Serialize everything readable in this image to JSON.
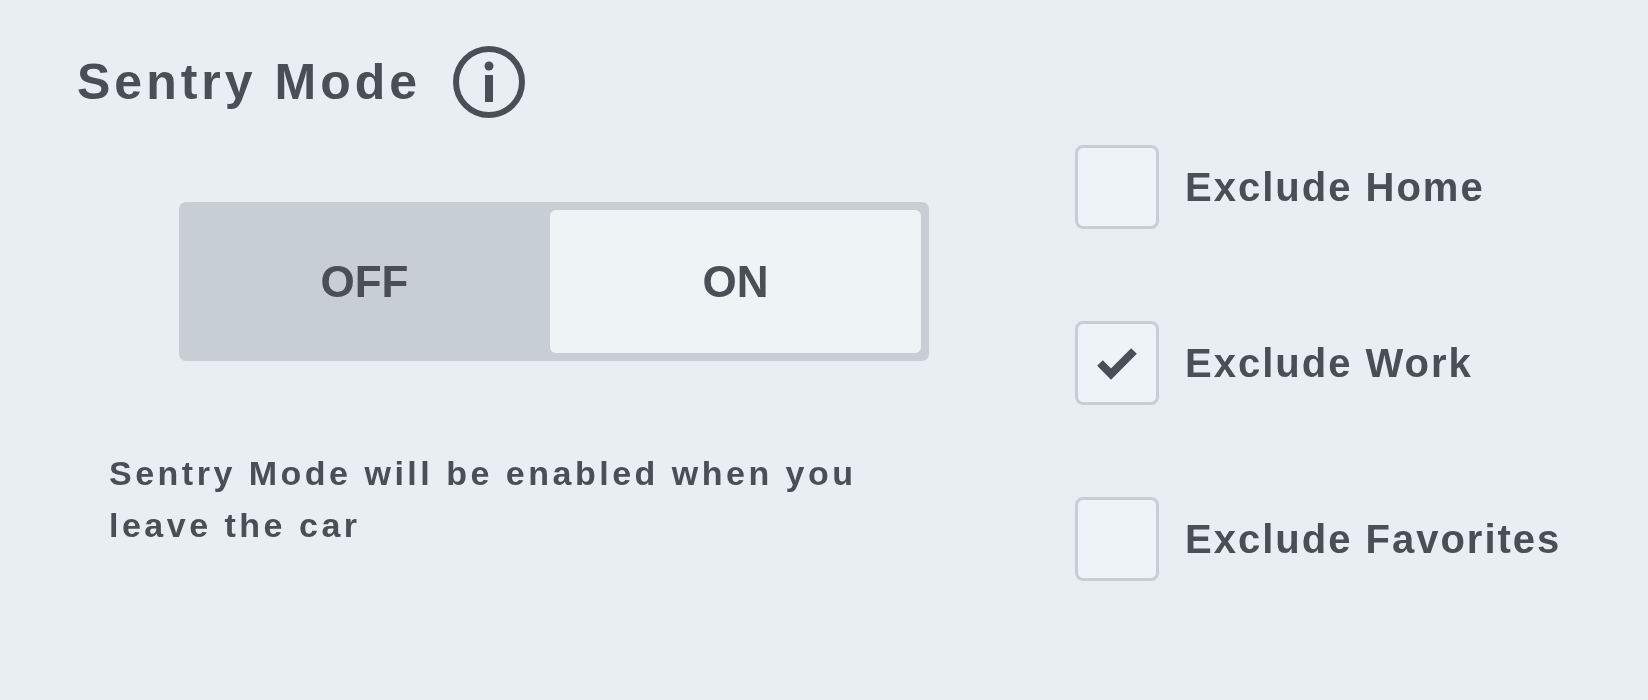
{
  "title": "Sentry Mode",
  "toggle": [
    {
      "label": "OFF",
      "selected": false
    },
    {
      "label": "ON",
      "selected": true
    }
  ],
  "description": "Sentry Mode will be enabled when you leave the car",
  "options": [
    {
      "label": "Exclude Home",
      "checked": false
    },
    {
      "label": "Exclude Work",
      "checked": true
    },
    {
      "label": "Exclude Favorites",
      "checked": false
    }
  ]
}
